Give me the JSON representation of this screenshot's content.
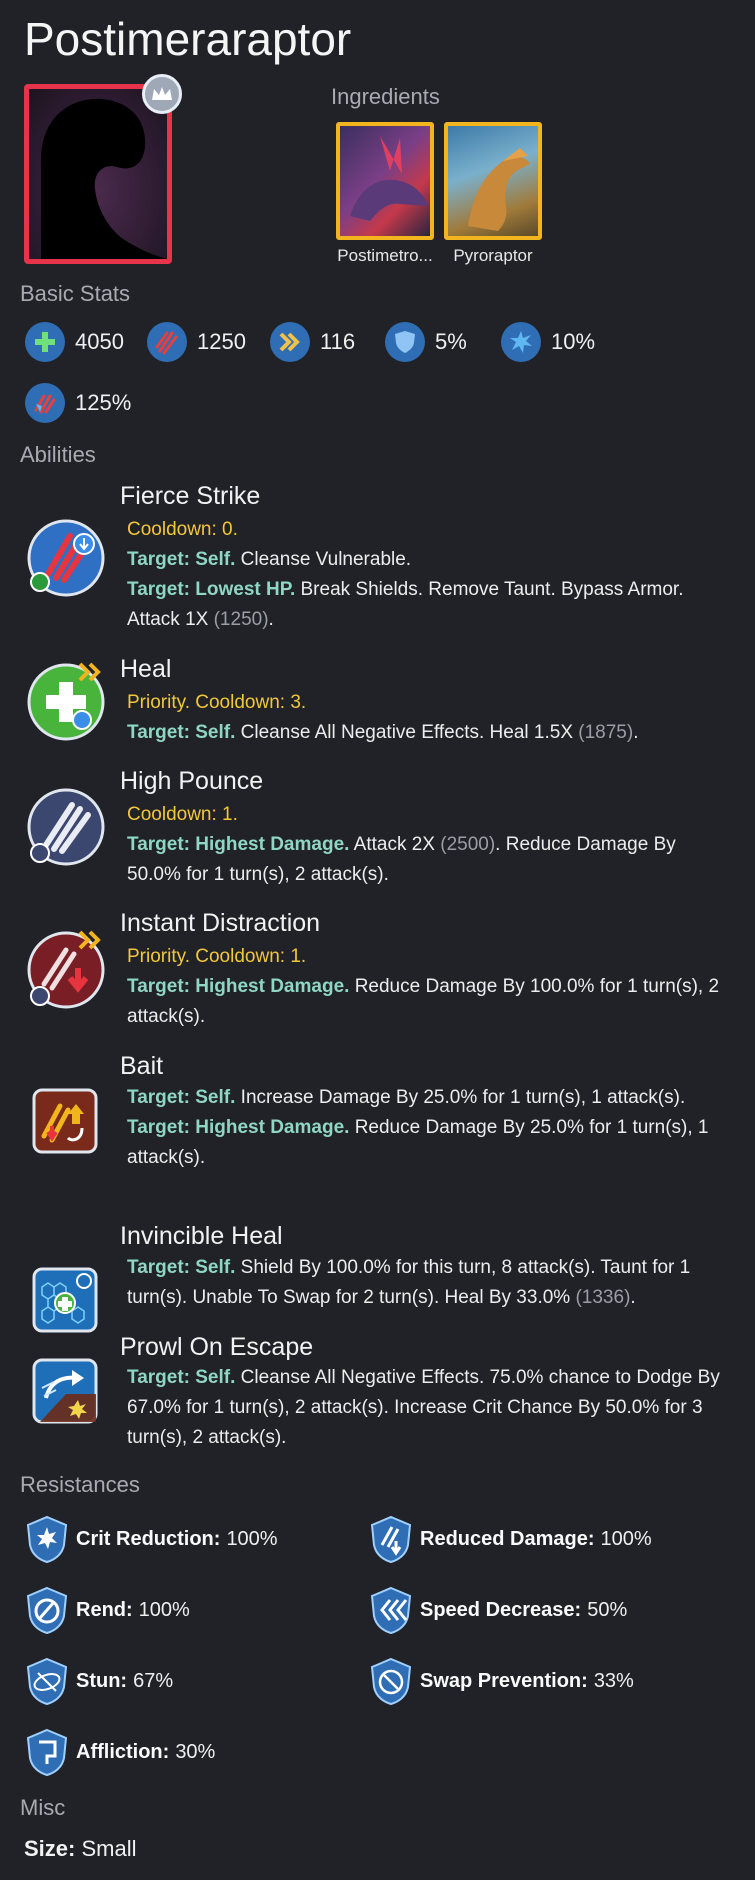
{
  "title": "Postimeraraptor",
  "sections": {
    "ingredients": "Ingredients",
    "basic_stats": "Basic Stats",
    "abilities": "Abilities",
    "resistances": "Resistances",
    "misc": "Misc"
  },
  "ingredients": [
    {
      "name": "Postimetro..."
    },
    {
      "name": "Pyroraptor"
    }
  ],
  "stats": [
    {
      "icon": "health-icon",
      "value": "4050"
    },
    {
      "icon": "damage-icon",
      "value": "1250"
    },
    {
      "icon": "speed-icon",
      "value": "116"
    },
    {
      "icon": "armor-icon",
      "value": "5%"
    },
    {
      "icon": "crit-chance-icon",
      "value": "10%"
    },
    {
      "icon": "crit-multiplier-icon",
      "value": "125%"
    }
  ],
  "abilities": [
    {
      "name": "Fierce Strike",
      "cooldown": "Cooldown: 0.",
      "lines": [
        {
          "target": "Target: Self.",
          "text": " Cleanse Vulnerable."
        },
        {
          "target": "Target: Lowest HP.",
          "text": " Break Shields. Remove Taunt. Bypass Armor. Attack 1X ",
          "num": "(1250)",
          "tail": "."
        }
      ]
    },
    {
      "name": "Heal",
      "cooldown": "Priority. Cooldown: 3.",
      "lines": [
        {
          "target": "Target: Self.",
          "text": " Cleanse All Negative Effects. Heal 1.5X ",
          "num": "(1875)",
          "tail": "."
        }
      ]
    },
    {
      "name": "High Pounce",
      "cooldown": "Cooldown: 1.",
      "lines": [
        {
          "target": "Target: Highest Damage.",
          "text": " Attack 2X ",
          "num": "(2500)",
          "tail": ". Reduce Damage By 50.0% for 1 turn(s), 2 attack(s)."
        }
      ]
    },
    {
      "name": "Instant Distraction",
      "cooldown": "Priority. Cooldown: 1.",
      "lines": [
        {
          "target": "Target: Highest Damage.",
          "text": " Reduce Damage By 100.0% for 1 turn(s), 2 attack(s)."
        }
      ]
    },
    {
      "name": "Bait",
      "cooldown": "",
      "lines": [
        {
          "target": "Target: Self.",
          "text": " Increase Damage By 25.0% for 1 turn(s), 1 attack(s)."
        },
        {
          "target": "Target: Highest Damage.",
          "text": " Reduce Damage By 25.0% for 1 turn(s), 1 attack(s)."
        }
      ]
    },
    {
      "name": "Invincible Heal",
      "cooldown": "",
      "lines": [
        {
          "target": "Target: Self.",
          "text": " Shield By 100.0% for this turn, 8 attack(s). Taunt for 1 turn(s). Unable To Swap for 2 turn(s). Heal By 33.0% ",
          "num": "(1336)",
          "tail": "."
        }
      ]
    },
    {
      "name": "Prowl On Escape",
      "cooldown": "",
      "lines": [
        {
          "target": "Target: Self.",
          "text": " Cleanse All Negative Effects. 75.0% chance to Dodge By 67.0% for 1 turn(s), 2 attack(s). Increase Crit Chance By 50.0% for 3 turn(s), 2 attack(s)."
        }
      ]
    }
  ],
  "resistances": [
    {
      "name": "Crit Reduction:",
      "value": "100%"
    },
    {
      "name": "Reduced Damage:",
      "value": "100%"
    },
    {
      "name": "Rend:",
      "value": "100%"
    },
    {
      "name": "Speed Decrease:",
      "value": "50%"
    },
    {
      "name": "Stun:",
      "value": "67%"
    },
    {
      "name": "Swap Prevention:",
      "value": "33%"
    },
    {
      "name": "Affliction:",
      "value": "30%"
    }
  ],
  "misc": {
    "size_label": "Size:",
    "size_value": "Small"
  }
}
